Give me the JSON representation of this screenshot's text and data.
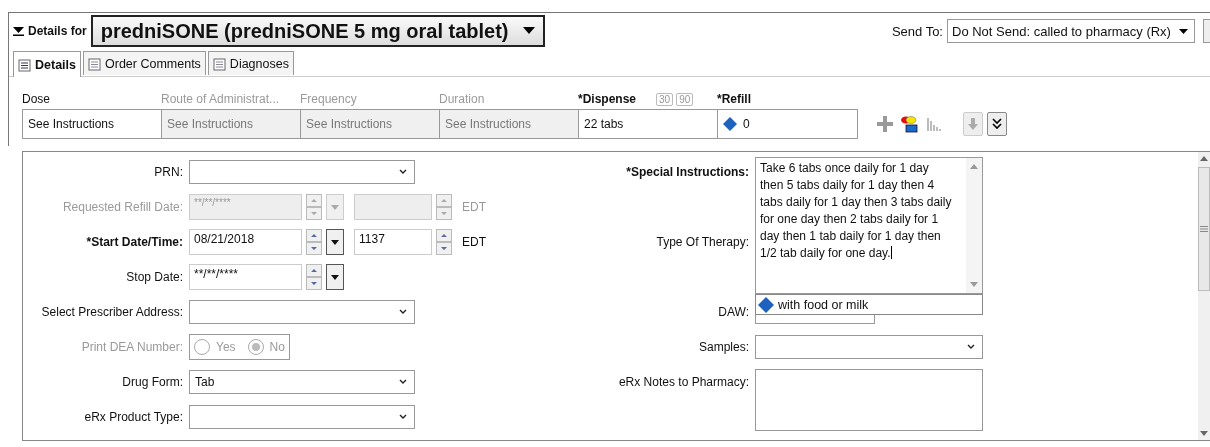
{
  "header": {
    "label": "Details for",
    "product": "predniSONE (predniSONE 5 mg oral tablet)",
    "send_to_label": "Send To:",
    "send_to_value": "Do Not Send: called to pharmacy (Rx)"
  },
  "tabs": [
    {
      "label": "Details",
      "selected": true
    },
    {
      "label": "Order Comments",
      "selected": false
    },
    {
      "label": "Diagnoses",
      "selected": false
    }
  ],
  "order_grid": [
    {
      "label": "Dose",
      "value": "See Instructions",
      "disabled": false,
      "required": false
    },
    {
      "label": "Route of Administrat...",
      "value": "See Instructions",
      "disabled": true,
      "required": false
    },
    {
      "label": "Frequency",
      "value": "See Instructions",
      "disabled": true,
      "required": false
    },
    {
      "label": "Duration",
      "value": "See Instructions",
      "disabled": true,
      "required": false
    },
    {
      "label": "*Dispense",
      "value": "22 tabs",
      "disabled": false,
      "required": true,
      "quick_buttons": [
        "30",
        "90"
      ]
    },
    {
      "label": "*Refill",
      "value": "0",
      "disabled": false,
      "required": true,
      "flagged": true
    }
  ],
  "left_fields": [
    {
      "kind": "select",
      "label": "PRN:",
      "disabled": false,
      "required": false
    },
    {
      "kind": "datetime",
      "label": "Requested Refill Date:",
      "value": "**/**/****",
      "zone": "EDT",
      "disabled": true,
      "required": false
    },
    {
      "kind": "datetime",
      "label": "*Start Date/Time:",
      "value": "08/21/2018",
      "time": "1137",
      "zone": "EDT",
      "disabled": false,
      "required": true
    },
    {
      "kind": "date",
      "label": "Stop Date:",
      "value": "**/**/****",
      "disabled": false,
      "required": false
    },
    {
      "kind": "select",
      "label": "Select Prescriber Address:",
      "disabled": false,
      "required": false
    },
    {
      "kind": "radio",
      "label": "Print DEA Number:",
      "disabled": true,
      "required": false,
      "options": [
        {
          "label": "Yes",
          "selected": false
        },
        {
          "label": "No",
          "selected": true
        }
      ]
    },
    {
      "kind": "select",
      "label": "Drug Form:",
      "value": "Tab",
      "disabled": false,
      "required": false
    },
    {
      "kind": "select",
      "label": "eRx Product Type:",
      "disabled": false,
      "required": false
    }
  ],
  "right_fields": {
    "special_instructions": {
      "label": "*Special Instructions:",
      "value": "Take 6 tabs once daily for 1 day then 5 tabs daily for 1 day then 4 tabs daily for 1 day then 3 tabs daily for one day then 2 tabs daily for 1 day then 1 tab daily for 1 day then 1/2 tab daily for one day.",
      "suggestion": "with food or milk"
    },
    "type_of_therapy_label": "Type Of Therapy:",
    "daw_label": "DAW:",
    "samples": {
      "label": "Samples:"
    },
    "erx_notes": {
      "label": "eRx Notes to Pharmacy:"
    }
  }
}
